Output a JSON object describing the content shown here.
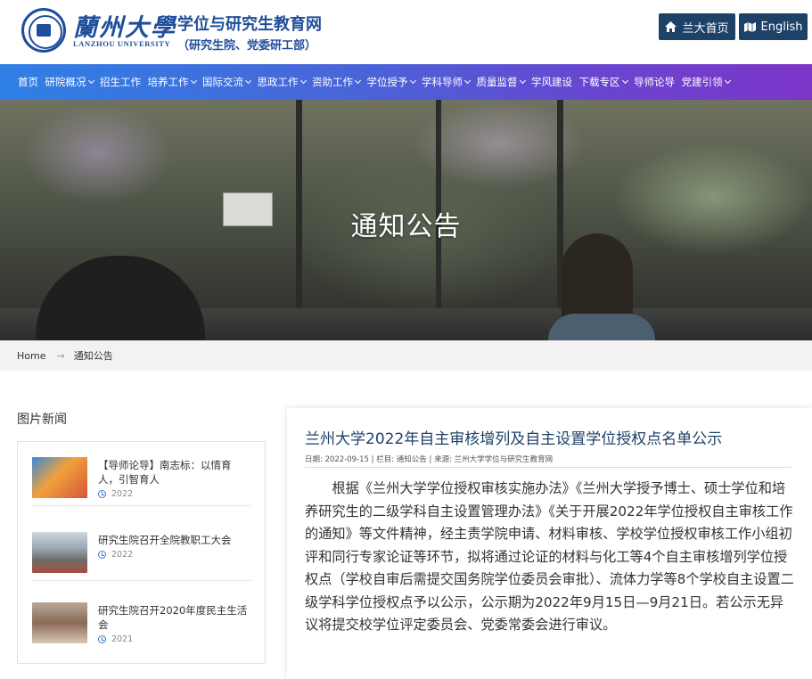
{
  "header": {
    "logo_cn": "蘭州大學",
    "logo_en": "LANZHOU UNIVERSITY",
    "site_title": "学位与研究生教育网",
    "site_subtitle": "（研究生院、党委研工部）",
    "home_button": "兰大首页",
    "english_button": "English"
  },
  "nav": {
    "items": [
      {
        "label": "首页",
        "dropdown": false
      },
      {
        "label": "研院概况",
        "dropdown": true
      },
      {
        "label": "招生工作",
        "dropdown": false
      },
      {
        "label": "培养工作",
        "dropdown": true
      },
      {
        "label": "国际交流",
        "dropdown": true
      },
      {
        "label": "思政工作",
        "dropdown": true
      },
      {
        "label": "资助工作",
        "dropdown": true
      },
      {
        "label": "学位授予",
        "dropdown": true
      },
      {
        "label": "学科导师",
        "dropdown": true
      },
      {
        "label": "质量监督",
        "dropdown": true
      },
      {
        "label": "学风建设",
        "dropdown": false
      },
      {
        "label": "下载专区",
        "dropdown": true
      },
      {
        "label": "导师论导",
        "dropdown": false
      },
      {
        "label": "党建引领",
        "dropdown": true
      }
    ]
  },
  "banner": {
    "title": "通知公告"
  },
  "breadcrumb": {
    "home": "Home",
    "arrow": "→",
    "current": "通知公告"
  },
  "sidebar": {
    "title": "图片新闻",
    "news": [
      {
        "title": "【导师论导】南志标：以情育人，引智育人",
        "date": "2022"
      },
      {
        "title": "研究生院召开全院教职工大会",
        "date": "2022"
      },
      {
        "title": "研究生院召开2020年度民主生活会",
        "date": "2021"
      }
    ]
  },
  "article": {
    "title": "兰州大学2022年自主审核增列及自主设置学位授权点名单公示",
    "meta": "日期: 2022-09-15 | 栏目: 通知公告 | 来源: 兰州大学学位与研究生教育网",
    "body": "根据《兰州大学学位授权审核实施办法》《兰州大学授予博士、硕士学位和培养研究生的二级学科自主设置管理办法》《关于开展2022年学位授权自主审核工作的通知》等文件精神，经主责学院申请、材料审核、学校学位授权审核工作小组初评和同行专家论证等环节，拟将通过论证的材料与化工等4个自主审核增列学位授权点（学校自审后需提交国务院学位委员会审批）、流体力学等8个学校自主设置二级学科学位授权点予以公示，公示期为2022年9月15日—9月21日。若公示无异议将提交校学位评定委员会、党委常委会进行审议。"
  },
  "colors": {
    "brand_blue": "#1f4e9b",
    "button_navy": "#1e4168",
    "nav_start": "#2f80e6",
    "nav_end": "#7c35c8"
  }
}
